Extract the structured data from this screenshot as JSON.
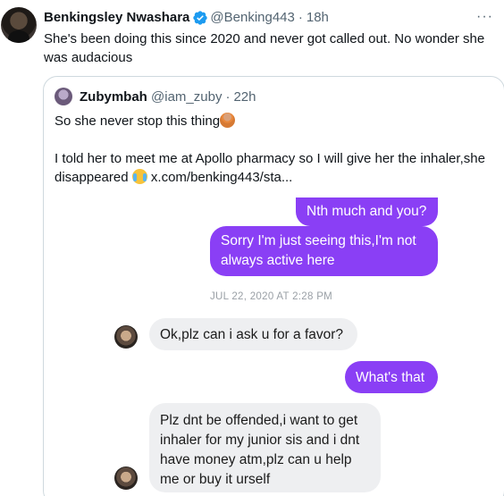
{
  "tweet": {
    "name": "Benkingsley Nwashara",
    "handle": "@Benking443",
    "separator": "·",
    "time": "18h",
    "more_label": "···",
    "text": "She's been doing this since 2020 and never got called out. No wonder she was audacious"
  },
  "quote": {
    "name": "Zubymbah",
    "handle": "@iam_zuby",
    "separator": "·",
    "time": "22h",
    "line1": "So she never stop this thing",
    "line2_prefix": "I told her to meet me at Apollo pharmacy so I will give her the inhaler,she disappeared",
    "link": "x.com/benking443/sta..."
  },
  "chat": {
    "messages": [
      {
        "text": "Nth much and you?"
      },
      {
        "text": "Sorry I'm just seeing this,I'm not always active here"
      },
      {
        "text": "Ok,plz can i ask u for a favor?"
      },
      {
        "text": "What's that"
      },
      {
        "text": "Plz dnt be offended,i want to get inhaler for my junior sis and i dnt have money atm,plz can u help me or buy it urself"
      }
    ],
    "timestamp": "JUL 22, 2020 AT 2:28 PM"
  },
  "icons": {
    "verified": "verified-badge-icon",
    "more": "more-options-icon",
    "emoji1": "person-gesturing-emoji",
    "emoji2": "crying-laughing-emoji"
  },
  "colors": {
    "accent_blue": "#1d9bf0",
    "outgoing_bubble": "#8a3ff5",
    "incoming_bubble": "#eeeff1"
  }
}
